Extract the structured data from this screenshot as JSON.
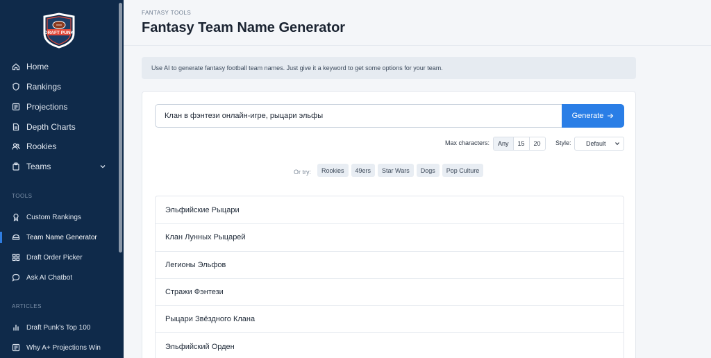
{
  "sidebar": {
    "logo_text": "DRAFT PUNK",
    "nav": [
      {
        "label": "Home",
        "icon": "home-icon"
      },
      {
        "label": "Rankings",
        "icon": "shield-icon"
      },
      {
        "label": "Projections",
        "icon": "newspaper-icon"
      },
      {
        "label": "Depth Charts",
        "icon": "document-icon"
      },
      {
        "label": "Rookies",
        "icon": "users-icon"
      },
      {
        "label": "Teams",
        "icon": "clipboard-icon"
      }
    ],
    "tools_label": "TOOLS",
    "tools": [
      {
        "label": "Custom Rankings",
        "icon": "award-icon"
      },
      {
        "label": "Team Name Generator",
        "icon": "helmet-icon",
        "active": true
      },
      {
        "label": "Draft Order Picker",
        "icon": "grid-icon"
      },
      {
        "label": "Ask AI Chatbot",
        "icon": "chat-icon"
      }
    ],
    "articles_label": "ARTICLES",
    "articles": [
      {
        "label": "Draft Punk's Top 100",
        "icon": "bar-chart-icon"
      },
      {
        "label": "Why A+ Projections Win",
        "icon": "newspaper-icon"
      }
    ]
  },
  "header": {
    "eyebrow": "FANTASY TOOLS",
    "title": "Fantasy Team Name Generator"
  },
  "info_text": "Use AI to generate fantasy football team names. Just give it a keyword to get some options for your team.",
  "search": {
    "value": "Клан в фэнтези онлайн-игре, рыцари эльфы",
    "button_label": "Generate"
  },
  "options": {
    "max_chars_label": "Max characters:",
    "max_chars_options": [
      "Any",
      "15",
      "20"
    ],
    "max_chars_selected": "Any",
    "style_label": "Style:",
    "style_value": "Default"
  },
  "suggestions": {
    "label": "Or try:",
    "chips": [
      "Rookies",
      "49ers",
      "Star Wars",
      "Dogs",
      "Pop Culture"
    ]
  },
  "results": [
    "Эльфийские Рыцари",
    "Клан Лунных Рыцарей",
    "Легионы Эльфов",
    "Стражи Фэнтези",
    "Рыцари Звёздного Клана",
    "Эльфийский Орден"
  ],
  "colors": {
    "sidebar_bg": "#0f2a4a",
    "accent": "#2a7ee6"
  }
}
